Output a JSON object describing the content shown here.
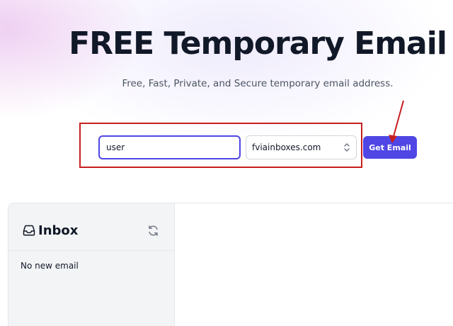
{
  "hero": {
    "title": "FREE Temporary Email",
    "subtitle": "Free, Fast, Private, and Secure temporary email address."
  },
  "form": {
    "username_value": "user",
    "domain_selected": "fviainboxes.com",
    "submit_label": "Get Email"
  },
  "inbox": {
    "title": "Inbox",
    "empty_message": "No new email",
    "icons": [
      "inbox-tray-icon",
      "refresh-icon"
    ]
  },
  "colors": {
    "accent": "#4f46e5",
    "annotation": "#c81e1e",
    "title_text": "#111827",
    "sidebar_bg": "#f3f4f6"
  }
}
